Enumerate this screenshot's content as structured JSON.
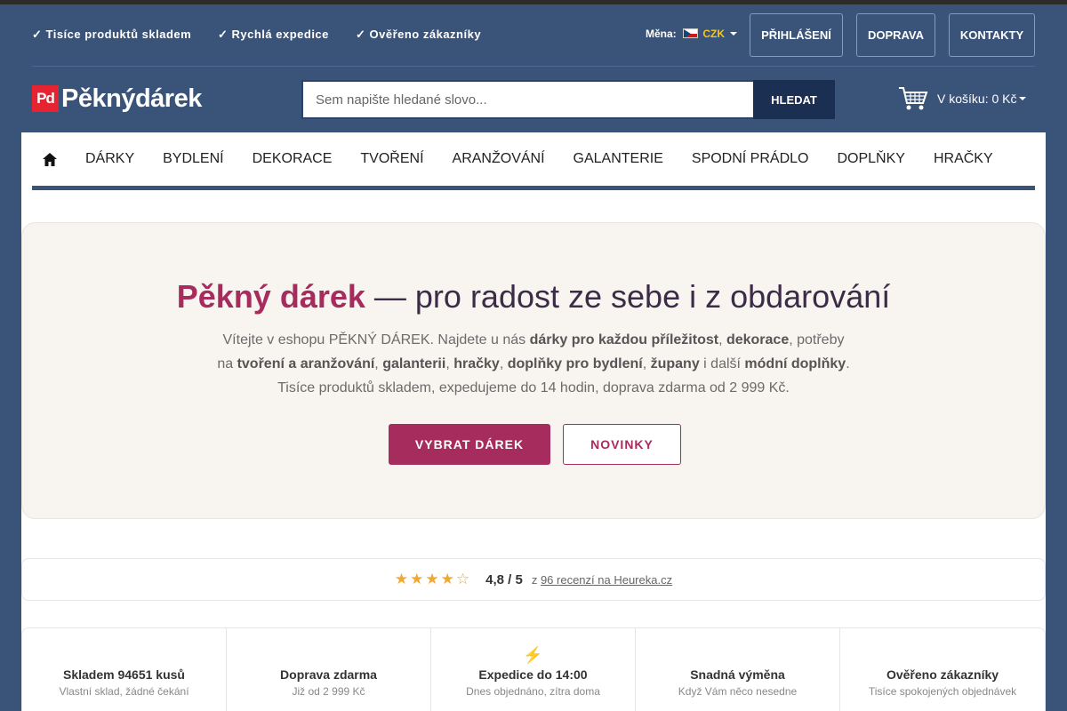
{
  "topbar": {
    "usps": [
      "✓ Tisíce produktů skladem",
      "✓ Rychlá expedice",
      "✓ Ověřeno zákazníky"
    ],
    "currency_label": "Měna:",
    "currency_code": "CZK",
    "login_label": "PŘIHLÁŠENÍ",
    "shipping_label": "DOPRAVA",
    "contacts_label": "KONTAKTY"
  },
  "header": {
    "logo_badge": "Pd",
    "logo_text": "Pěknýdárek",
    "search_placeholder": "Sem napište hledané slovo...",
    "search_button": "HLEDAT",
    "cart_label": "V košíku: 0 Kč"
  },
  "nav": {
    "home_icon": "home-icon",
    "items": [
      "DÁRKY",
      "BYDLENÍ",
      "DEKORACE",
      "TVOŘENÍ",
      "ARANŽOVÁNÍ",
      "GALANTERIE",
      "SPODNÍ PRÁDLO",
      "DOPLŇKY",
      "HRAČKY"
    ]
  },
  "hero": {
    "title_accent": "Pěkný dárek",
    "title_rest": " — pro radost ze sebe i z obdarování",
    "line1_a": "Vítejte v eshopu PĚKNÝ DÁREK. Najdete u nás ",
    "line1_b": "dárky pro každou příležitost",
    "line1_c": ", ",
    "line1_d": "dekorace",
    "line1_e": ", potřeby",
    "line2_a": "na ",
    "line2_b": "tvoření a aranžování",
    "line2_c": ", ",
    "line2_d": "galanterii",
    "line2_e": ", ",
    "line2_f": "hračky",
    "line2_g": ", ",
    "line2_h": "doplňky pro bydlení",
    "line2_i": ", ",
    "line2_j": "župany",
    "line2_k": " i další ",
    "line2_l": "módní doplňky",
    "line2_m": ".",
    "line3": "Tisíce produktů skladem, expedujeme do 14 hodin, doprava zdarma od 2 999 Kč.",
    "primary_button": "VYBRAT DÁREK",
    "secondary_button": "NOVINKY"
  },
  "rating": {
    "stars": "★★★★☆",
    "score": "4,8 / 5",
    "prefix": "z ",
    "link": "96 recenzí na Heureka.cz"
  },
  "features": [
    {
      "icon": "",
      "title": "Skladem 94651 kusů",
      "sub": "Vlastní sklad, žádné čekání"
    },
    {
      "icon": "",
      "title": "Doprava zdarma",
      "sub": "Již od 2 999 Kč"
    },
    {
      "icon": "⚡",
      "title": "Expedice do 14:00",
      "sub": "Dnes objednáno, zítra doma"
    },
    {
      "icon": "",
      "title": "Snadná výměna",
      "sub": "Když Vám něco nesedne"
    },
    {
      "icon": "",
      "title": "Ověřeno zákazníky",
      "sub": "Tisíce spokojených objednávek"
    }
  ],
  "colors": {
    "header_bg": "#3a5378",
    "accent": "#a72c5e",
    "search_button": "#1b2f52",
    "logo_red": "#e52331"
  }
}
